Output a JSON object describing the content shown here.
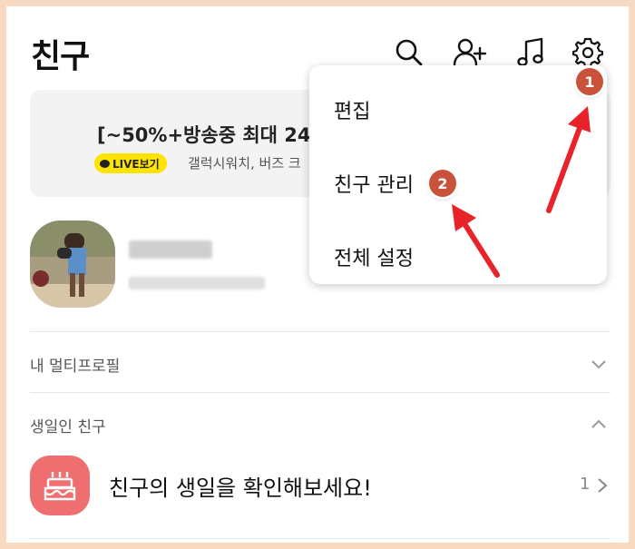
{
  "header": {
    "title": "친구",
    "icons": [
      "search-icon",
      "add-friend-icon",
      "music-icon",
      "settings-icon"
    ]
  },
  "banner": {
    "title": "[~50%+방송중 최대 24",
    "live_label": "LIVE보기",
    "subtitle": "갤럭시워치, 버즈 크"
  },
  "sections": {
    "multi_profile": "내 멀티프로필",
    "birthday": "생일인 친구"
  },
  "birthday_item": {
    "text": "친구의 생일을 확인해보세요!",
    "count": "1"
  },
  "menu": {
    "items": [
      "편집",
      "친구 관리",
      "전체 설정"
    ]
  },
  "annotations": {
    "badge1": "1",
    "badge2": "2"
  },
  "colors": {
    "frame": "#f8d9c2",
    "live_pill": "#fde400",
    "birthday_icon": "#ef6f71",
    "badge": "#c9523b",
    "arrow": "#e8232a"
  }
}
